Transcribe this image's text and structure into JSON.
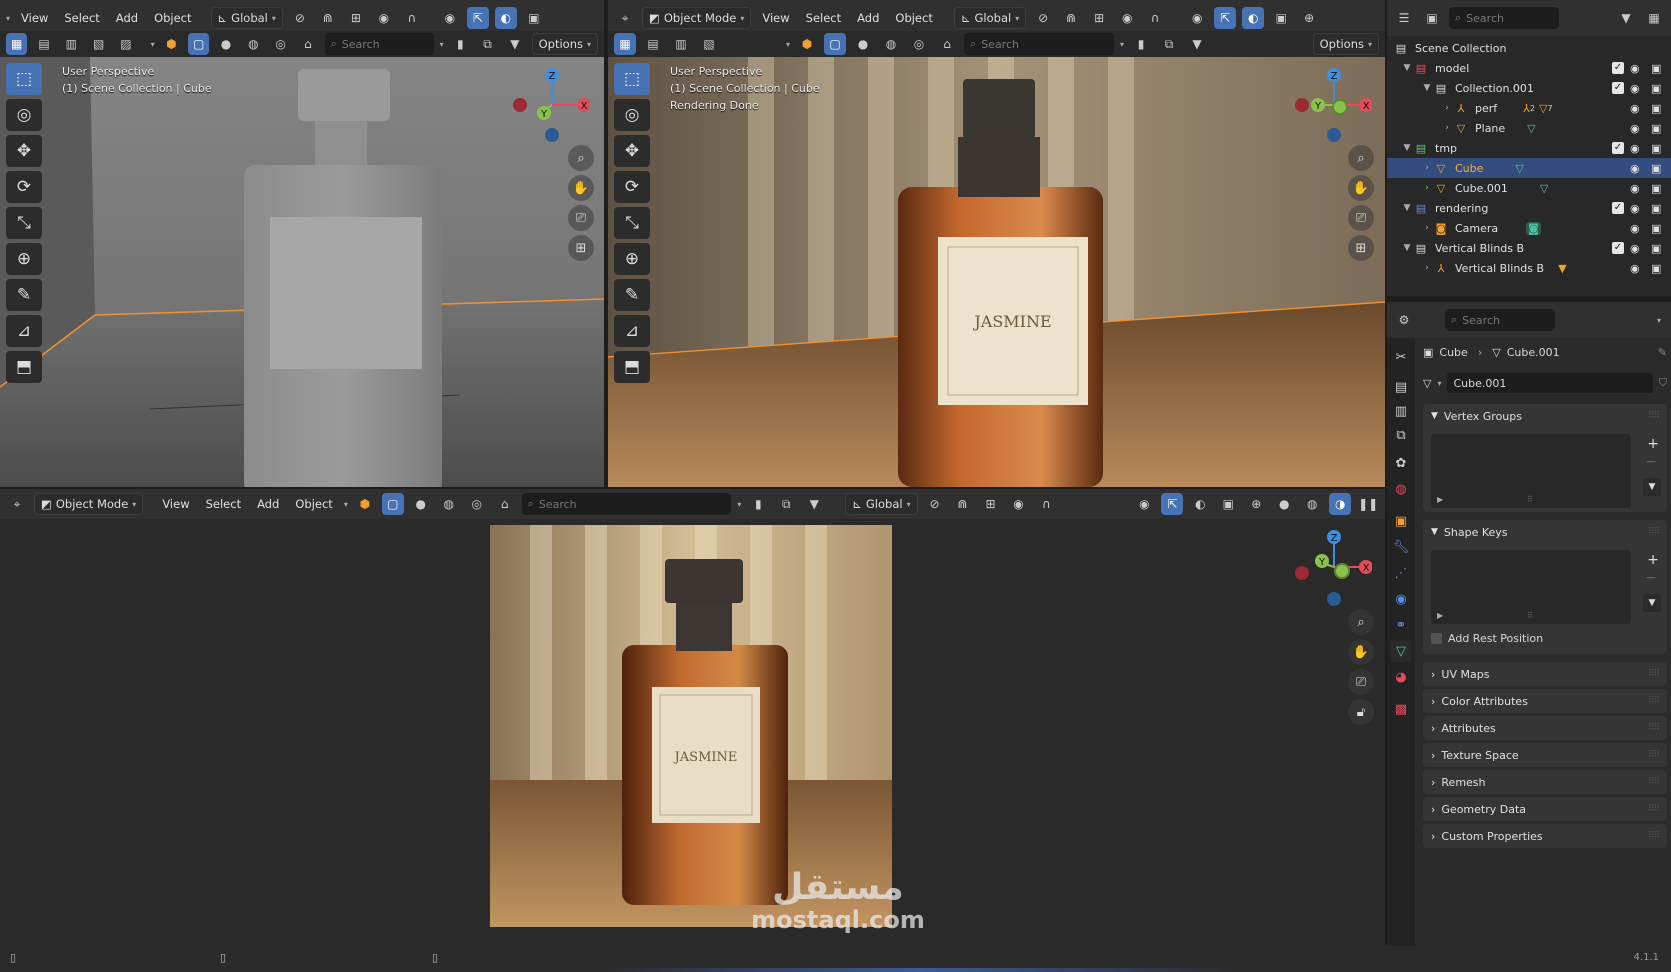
{
  "menus": {
    "view": "View",
    "select": "Select",
    "add": "Add",
    "object": "Object"
  },
  "header": {
    "transform_orientation": "Global",
    "mode": "Object Mode",
    "search_placeholder": "Search",
    "options": "Options"
  },
  "viewport_left": {
    "line1": "User Perspective",
    "line2": "(1) Scene Collection | Cube"
  },
  "viewport_right": {
    "line1": "User Perspective",
    "line2": "(1) Scene Collection | Cube",
    "line3": "Rendering Done"
  },
  "gizmo": {
    "x": "X",
    "y": "Y",
    "z": "Z"
  },
  "perfume": {
    "brand": "JASMINE"
  },
  "outliner": {
    "search_placeholder": "Search",
    "scene_collection": "Scene Collection",
    "rows": [
      {
        "label": "model"
      },
      {
        "label": "Collection.001"
      },
      {
        "label": "perf",
        "badge1": "2",
        "badge2": "7"
      },
      {
        "label": "Plane"
      },
      {
        "label": "tmp"
      },
      {
        "label": "Cube"
      },
      {
        "label": "Cube.001"
      },
      {
        "label": "rendering"
      },
      {
        "label": "Camera"
      },
      {
        "label": "Vertical Blinds B"
      },
      {
        "label": "Vertical Blinds B"
      }
    ]
  },
  "properties": {
    "search_placeholder": "Search",
    "breadcrumb_object": "Cube",
    "breadcrumb_data": "Cube.001",
    "mesh_name": "Cube.001",
    "vertex_groups": "Vertex Groups",
    "shape_keys": "Shape Keys",
    "add_rest_position": "Add Rest Position",
    "collapsed": [
      "UV Maps",
      "Color Attributes",
      "Attributes",
      "Texture Space",
      "Remesh",
      "Geometry Data",
      "Custom Properties"
    ]
  },
  "watermark": {
    "arabic": "مستقل",
    "latin": "mostaql.com"
  },
  "status": {
    "version": "4.1.1"
  },
  "colors": {
    "accent": "#4772b3",
    "selected_row": "#334d80",
    "axis_x": "#e54b5b",
    "axis_y": "#8bc34a",
    "axis_z": "#3d8fe0",
    "mesh_green": "#4fc3a1",
    "object_orange": "#f0a030"
  }
}
